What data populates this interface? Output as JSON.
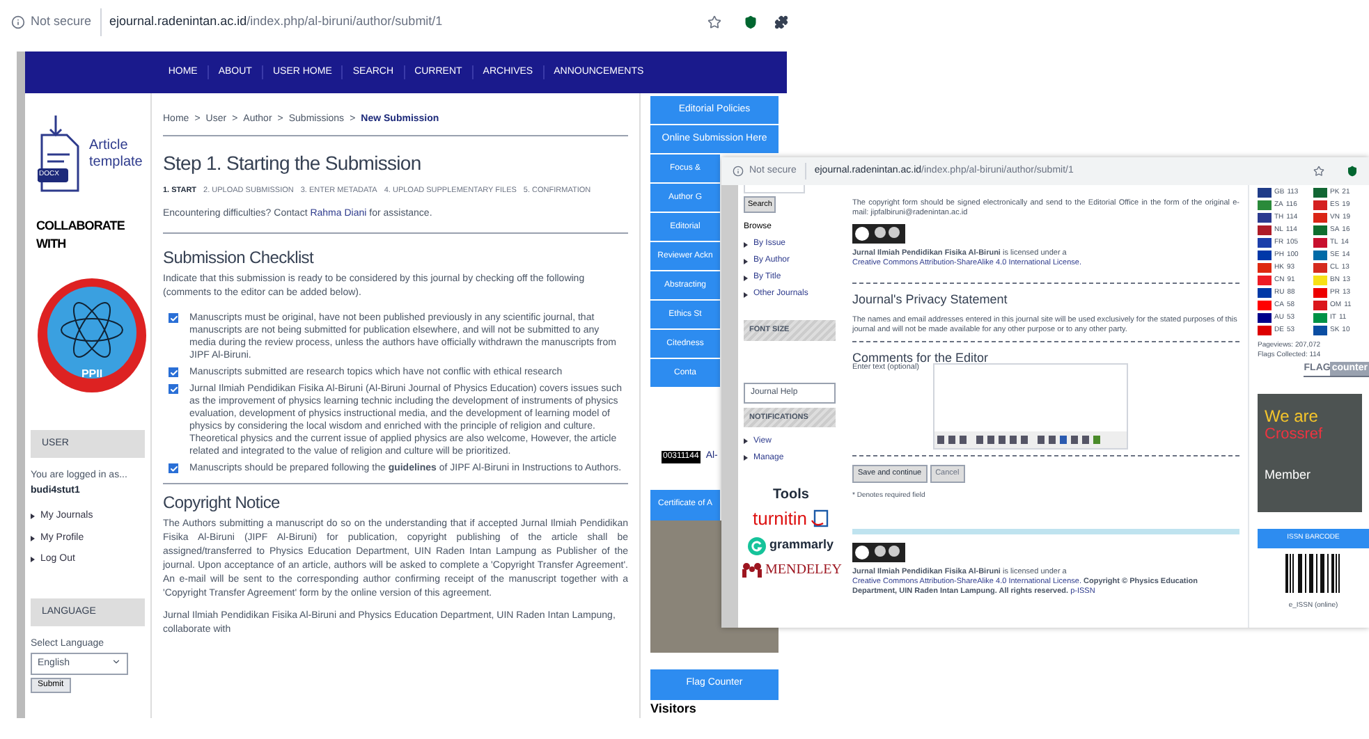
{
  "browser": {
    "security": "Not secure",
    "host": "ejournal.radenintan.ac.id",
    "path": "/index.php/al-biruni/author/submit/1"
  },
  "nav": [
    "HOME",
    "ABOUT",
    "USER HOME",
    "SEARCH",
    "CURRENT",
    "ARCHIVES",
    "ANNOUNCEMENTS"
  ],
  "left_sidebar": {
    "template_badge": "DOCX",
    "template_label": "Article template",
    "collaborate_title": "COLLABORATE WITH",
    "logo_text": "PPII",
    "user_header": "USER",
    "logged_in_text": "You are logged in as...",
    "username": "budi4stut1",
    "user_links": [
      "My Journals",
      "My Profile",
      "Log Out"
    ],
    "language_header": "LANGUAGE",
    "select_label": "Select Language",
    "language_value": "English",
    "submit_label": "Submit"
  },
  "main": {
    "breadcrumb_separator": ">",
    "breadcrumb": [
      "Home",
      "User",
      "Author",
      "Submissions",
      "New Submission"
    ],
    "title": "Step 1. Starting the Submission",
    "steps": [
      {
        "label": "1. START",
        "selected": true
      },
      {
        "label": "2. UPLOAD SUBMISSION",
        "selected": false
      },
      {
        "label": "3. ENTER METADATA",
        "selected": false
      },
      {
        "label": "4. UPLOAD SUPPLEMENTARY FILES",
        "selected": false
      },
      {
        "label": "5. CONFIRMATION",
        "selected": false
      }
    ],
    "help": {
      "before": "Encountering difficulties? Contact ",
      "link": "Rahma Diani",
      "after": " for assistance."
    },
    "checklist_title": "Submission Checklist",
    "checklist_intro": "Indicate that this submission is ready to be considered by this journal by checking off the following (comments to the editor can be added below).",
    "checklist": [
      {
        "text": "Manuscripts must be original, have not been published previously in any scientific journal, that manuscripts are not being submitted for publication elsewhere, and will not be submitted to any media during the review process, unless the authors have officially withdrawn the manuscripts from JIPF Al-Biruni.",
        "checked": true
      },
      {
        "text": "Manuscripts submitted are research topics which have not conflic with ethical research",
        "checked": true
      },
      {
        "text": "Jurnal Ilmiah Pendidikan Fisika Al-Biruni (Al-Biruni Journal of Physics Education) covers issues such as the improvement of physics learning technic including the development of instruments of physics evaluation, development of physics instructional media, and the development of learning model of physics by considering the local wisdom and enriched with the principle of religion and culture. Theoretical physics and the current issue of applied physics are also welcome, However, the article related and integrated to the value of religion and culture will be prioritized.",
        "checked": true
      },
      {
        "text": "Manuscripts should be prepared following the **guidelines** of JIPF Al-Biruni in Instructions to Authors.",
        "checked": true
      }
    ],
    "copyright_title": "Copyright Notice",
    "copyright_text": "The Authors submitting a manuscript do so on the understanding that if accepted Jurnal Ilmiah Pendidikan Fisika Al-Biruni (JIPF Al-Biruni) for publication, copyright publishing of the article shall be assigned/transferred to Physics Education Department, UIN Raden Intan Lampung as Publisher of the journal. Upon acceptance of an article, authors will be asked to complete a 'Copyright Transfer Agreement'. An e-mail will be sent to the corresponding author confirming receipt of the manuscript together with a 'Copyright Transfer Agreement' form by the online version of this agreement.",
    "copyright_text_2": "Jurnal Ilmiah Pendidikan Fisika Al-Biruni and Physics Education Department, UIN Raden Intan Lampung, collaborate with"
  },
  "right_sidebar": {
    "menu": [
      "Editorial Policies",
      "Online Submission Here",
      "Focus &",
      "Author G",
      "Editorial",
      "Reviewer Ackn",
      "Abstracting",
      "Ethics St",
      "Citedness",
      "Conta"
    ],
    "counter_digits": "00311144",
    "counter_label": "Al-",
    "certificate_title": "Certificate of A",
    "flag_counter_title": "Flag Counter",
    "visitors": "Visitors"
  },
  "overlay": {
    "browser": {
      "security": "Not secure",
      "host": "ejournal.radenintan.ac.id",
      "path": "/index.php/al-biruni/author/submit/1"
    },
    "sidebar": {
      "search_button": "Search",
      "browse": "Browse",
      "browse_links": [
        "By Issue",
        "By Author",
        "By Title",
        "Other Journals"
      ],
      "font_size": "FONT SIZE",
      "help_button": "Journal Help",
      "notifications": "NOTIFICATIONS",
      "notification_links": [
        "View",
        "Manage"
      ],
      "tools_title": "Tools",
      "tools": [
        {
          "kind": "turnitin",
          "label": "turnitin"
        },
        {
          "kind": "grammarly",
          "label": "grammarly"
        },
        {
          "kind": "mendeley",
          "label": "MENDELEY"
        }
      ]
    },
    "content": {
      "copyright_text": "The copyright form should be signed electronically and send to the Editorial Office in the form of the original e-mail: jipfalbiruni@radenintan.ac.id",
      "license_owner": "Jurnal Ilmiah Pendidikan Fisika Al-Biruni",
      "license_middle": " is licensed under a ",
      "license_link": "Creative Commons Attribution-ShareAlike 4.0 International License.",
      "privacy_title": "Journal's Privacy Statement",
      "privacy_text": "The names and email addresses entered in this journal site will be used exclusively for the stated purposes of this journal and will not be made available for any other purpose or to any other party.",
      "comments_title": "Comments for the Editor",
      "comments_label": "Enter text (optional)",
      "buttons": [
        "Save and continue",
        "Cancel"
      ],
      "required_note": "* Denotes required field",
      "footer_owner": "Jurnal Ilmiah Pendidikan Fisika Al-Biruni",
      "footer_middle": " is licensed under a ",
      "footer_link": "Creative Commons Attribution-ShareAlike 4.0 International License.",
      "footer_copyright": " Copyright © Physics Education Department, UIN Raden Intan Lampung. All rights reserved. ",
      "footer_issn": "p-ISSN"
    },
    "right": {
      "flags": [
        {
          "code": "GB",
          "count": "113",
          "color": "#1f3c88"
        },
        {
          "code": "PK",
          "count": "21",
          "color": "#116633"
        },
        {
          "code": "ZA",
          "count": "116",
          "color": "#2a8a3a"
        },
        {
          "code": "ES",
          "count": "19",
          "color": "#d42020"
        },
        {
          "code": "TH",
          "count": "114",
          "color": "#2b3a8f"
        },
        {
          "code": "VN",
          "count": "19",
          "color": "#da2516"
        },
        {
          "code": "NL",
          "count": "114",
          "color": "#ae1c28"
        },
        {
          "code": "SA",
          "count": "16",
          "color": "#0f6e2f"
        },
        {
          "code": "FR",
          "count": "105",
          "color": "#1c3faa"
        },
        {
          "code": "TL",
          "count": "14",
          "color": "#c8102e"
        },
        {
          "code": "PH",
          "count": "100",
          "color": "#0038a8"
        },
        {
          "code": "SE",
          "count": "14",
          "color": "#006aa7"
        },
        {
          "code": "HK",
          "count": "93",
          "color": "#de2910"
        },
        {
          "code": "CL",
          "count": "13",
          "color": "#d52b1e"
        },
        {
          "code": "CN",
          "count": "91",
          "color": "#ee1c25"
        },
        {
          "code": "BN",
          "count": "13",
          "color": "#f7e017"
        },
        {
          "code": "RU",
          "count": "88",
          "color": "#0039a6"
        },
        {
          "code": "PR",
          "count": "13",
          "color": "#ed0000"
        },
        {
          "code": "CA",
          "count": "58",
          "color": "#ff0000"
        },
        {
          "code": "OM",
          "count": "11",
          "color": "#db161b"
        },
        {
          "code": "AU",
          "count": "53",
          "color": "#00008b"
        },
        {
          "code": "IT",
          "count": "11",
          "color": "#009246"
        },
        {
          "code": "DE",
          "count": "53",
          "color": "#dd0000"
        },
        {
          "code": "SK",
          "count": "10",
          "color": "#0b4ea2"
        }
      ],
      "pageviews": "Pageviews: 207,072",
      "flags_collected": "Flags Collected: 114",
      "flag_logo_1": "FLAG",
      "flag_logo_2": "counter",
      "crossref_1": "We are",
      "crossref_2": "Crossref",
      "crossref_3": "Member",
      "issn_header": "ISSN BARCODE",
      "issn_caption": "e_ISSN (online)"
    }
  }
}
